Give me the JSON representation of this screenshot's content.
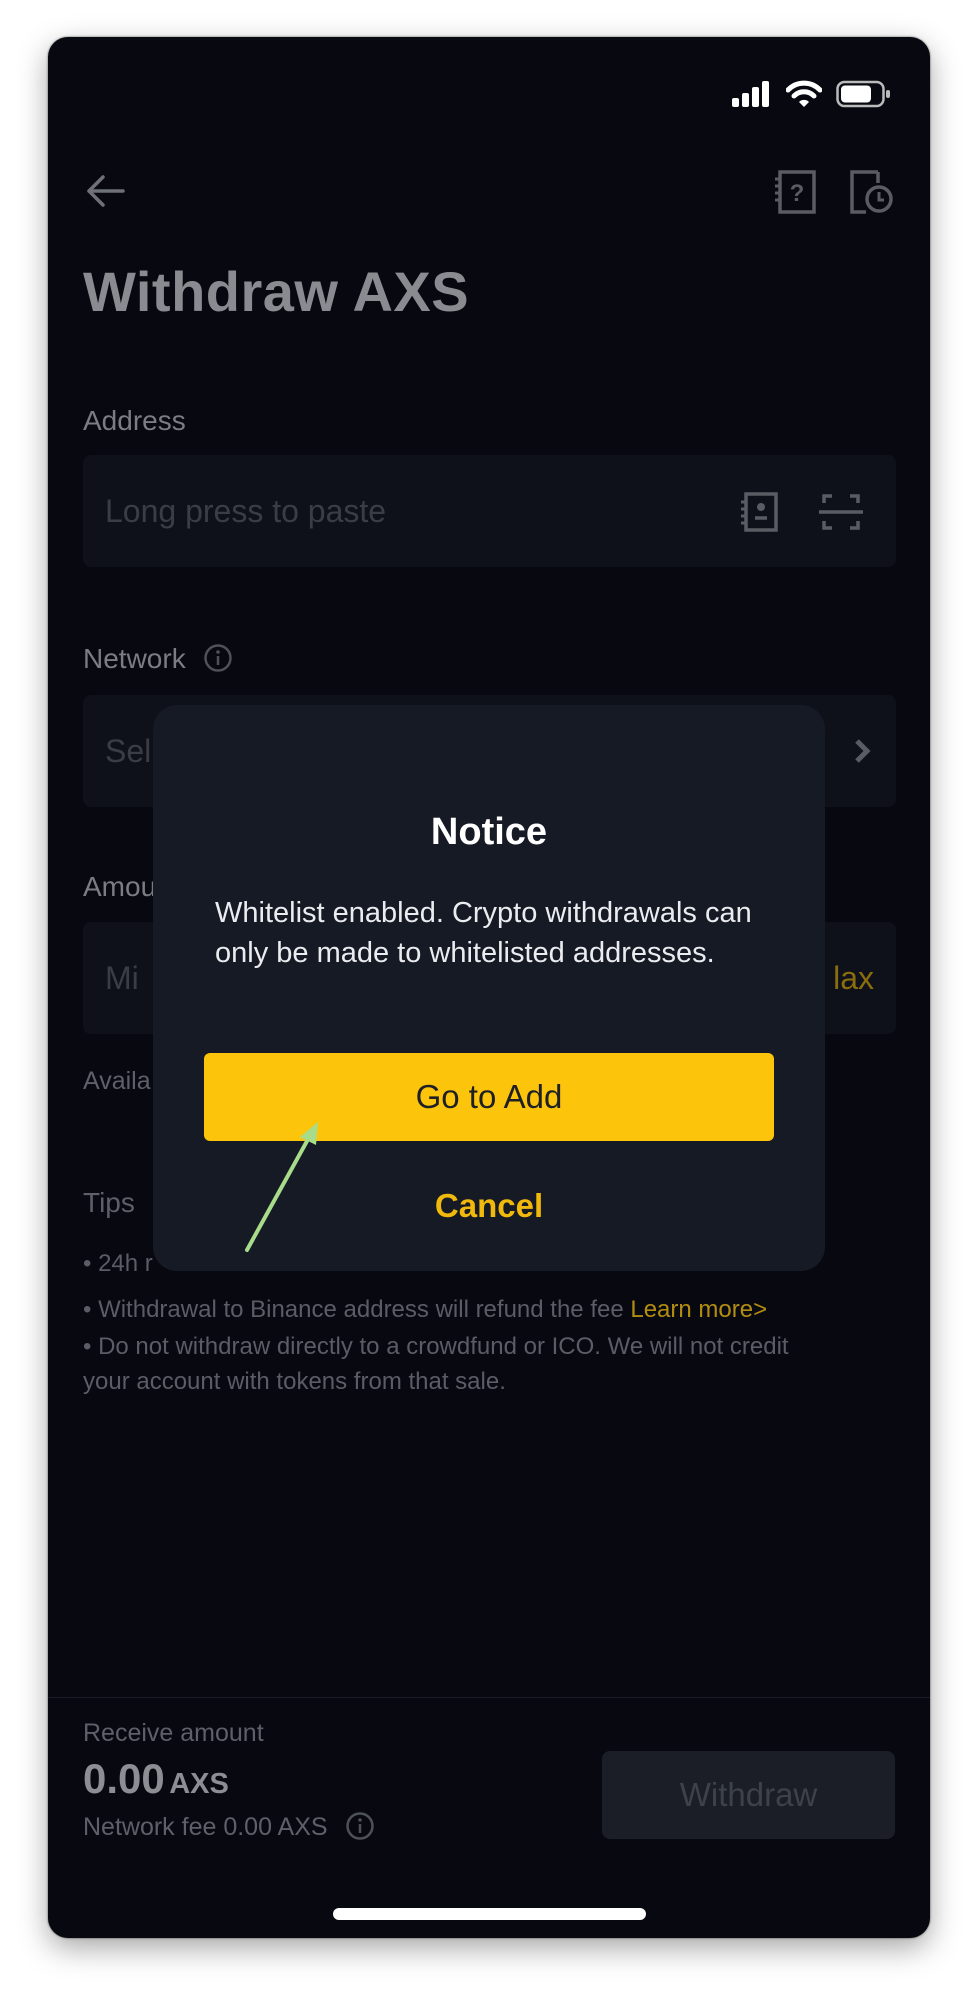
{
  "status_bar": {
    "icons": [
      "cellular-signal-icon",
      "wifi-icon",
      "battery-icon"
    ]
  },
  "header": {
    "back_icon": "arrow-left-icon",
    "help_icon": "faq-book-icon",
    "history_icon": "history-clock-icon",
    "title": "Withdraw AXS"
  },
  "form": {
    "address": {
      "label": "Address",
      "placeholder": "Long press to paste",
      "icons": [
        "address-book-icon",
        "scan-icon"
      ]
    },
    "network": {
      "label": "Network",
      "info_icon": "info-icon",
      "placeholder_visible": "Sel",
      "chevron_icon": "chevron-right-icon"
    },
    "amount": {
      "label_visible": "Amou",
      "placeholder_visible": "Mi",
      "max_visible": "lax"
    },
    "available_visible": "Availa"
  },
  "tips": {
    "heading": "Tips",
    "items": [
      {
        "text_visible": "• 24h r"
      },
      {
        "text": "• Withdrawal to Binance address will refund the fee",
        "link": "Learn more>"
      },
      {
        "text": "• Do not withdraw directly to a crowdfund or ICO. We will not credit"
      },
      {
        "text": "your account with tokens from that sale."
      }
    ]
  },
  "footer": {
    "receive_label": "Receive amount",
    "receive_value": "0.00",
    "receive_unit": "AXS",
    "network_fee": "Network fee 0.00 AXS",
    "withdraw_label": "Withdraw"
  },
  "modal": {
    "title": "Notice",
    "body": "Whitelist enabled. Crypto withdrawals can only be made to whitelisted addresses.",
    "primary_label": "Go to Add",
    "cancel_label": "Cancel"
  },
  "annotation": {
    "type": "arrow",
    "color": "#a8dc8a",
    "points_to": "Go to Add"
  },
  "colors": {
    "background": "#070810",
    "modal_bg": "#161a25",
    "accent": "#fcc40a",
    "accent_text": "#f0b90b"
  }
}
